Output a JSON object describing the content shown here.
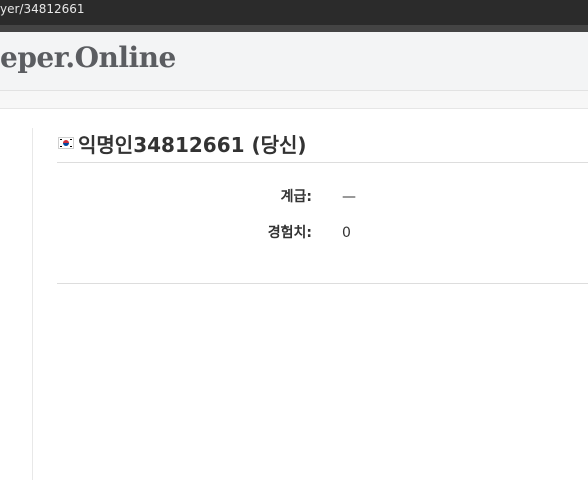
{
  "browser": {
    "url_text": "yer/34812661"
  },
  "site": {
    "title": "eper.Online"
  },
  "profile": {
    "flag": "south-korea-flag-icon",
    "name": "익명인34812661 (당신)",
    "stats": [
      {
        "label": "계급:",
        "value": "—"
      },
      {
        "label": "경험치:",
        "value": "0"
      }
    ]
  }
}
